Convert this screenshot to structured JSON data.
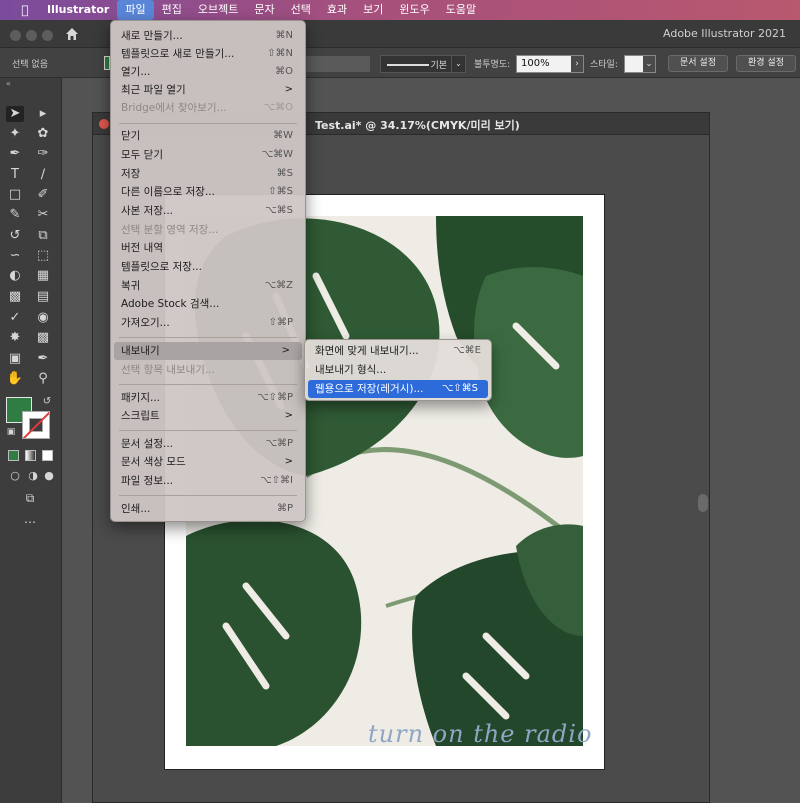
{
  "menubar": {
    "app_name": "Illustrator",
    "items": [
      "파일",
      "편집",
      "오브젝트",
      "문자",
      "선택",
      "효과",
      "보기",
      "윈도우",
      "도움말"
    ]
  },
  "titlebar": {
    "title": "Adobe Illustrator 2021"
  },
  "controlbar": {
    "selection": "선택 없음",
    "stroke_style": "기본",
    "opacity_label": "불투명도:",
    "opacity_value": "100%",
    "style_label": "스타일:",
    "doc_setup": "문서 설정",
    "preferences": "환경 설정"
  },
  "document": {
    "tab_title": "Test.ai* @ 34.17%(CMYK/미리 보기)",
    "watermark": "turn on the radio"
  },
  "file_menu": {
    "items": [
      {
        "label": "새로 만들기...",
        "shortcut": "⌘N"
      },
      {
        "label": "템플릿으로 새로 만들기...",
        "shortcut": "⇧⌘N"
      },
      {
        "label": "열기...",
        "shortcut": "⌘O"
      },
      {
        "label": "최근 파일 열기",
        "shortcut": ">"
      },
      {
        "label": "Bridge에서 찾아보기...",
        "shortcut": "⌥⌘O"
      },
      {
        "label": "닫기",
        "shortcut": "⌘W"
      },
      {
        "label": "모두 닫기",
        "shortcut": "⌥⌘W"
      },
      {
        "label": "저장",
        "shortcut": "⌘S"
      },
      {
        "label": "다른 이름으로 저장...",
        "shortcut": "⇧⌘S"
      },
      {
        "label": "사본 저장...",
        "shortcut": "⌥⌘S"
      },
      {
        "label": "선택 분할 영역 저장...",
        "shortcut": ""
      },
      {
        "label": "버전 내역",
        "shortcut": ""
      },
      {
        "label": "템플릿으로 저장...",
        "shortcut": ""
      },
      {
        "label": "복귀",
        "shortcut": "⌥⌘Z"
      },
      {
        "label": "Adobe Stock 검색...",
        "shortcut": ""
      },
      {
        "label": "가져오기...",
        "shortcut": "⇧⌘P"
      },
      {
        "label": "내보내기",
        "shortcut": ">"
      },
      {
        "label": "선택 항목 내보내기...",
        "shortcut": ""
      },
      {
        "label": "패키지...",
        "shortcut": "⌥⇧⌘P"
      },
      {
        "label": "스크립트",
        "shortcut": ">"
      },
      {
        "label": "문서 설정...",
        "shortcut": "⌥⌘P"
      },
      {
        "label": "문서 색상 모드",
        "shortcut": ">"
      },
      {
        "label": "파일 정보...",
        "shortcut": "⌥⇧⌘I"
      },
      {
        "label": "인쇄...",
        "shortcut": "⌘P"
      }
    ]
  },
  "export_submenu": {
    "items": [
      {
        "label": "화면에 맞게 내보내기...",
        "shortcut": "⌥⌘E"
      },
      {
        "label": "내보내기 형식...",
        "shortcut": ""
      },
      {
        "label": "웹용으로 저장(레거시)...",
        "shortcut": "⌥⇧⌘S"
      }
    ]
  },
  "colors": {
    "fill": "#2f7d43",
    "menu_highlight": "#2d6bdb",
    "menubar_gradient_start": "#7a4b9c",
    "menubar_gradient_end": "#b9586f"
  }
}
